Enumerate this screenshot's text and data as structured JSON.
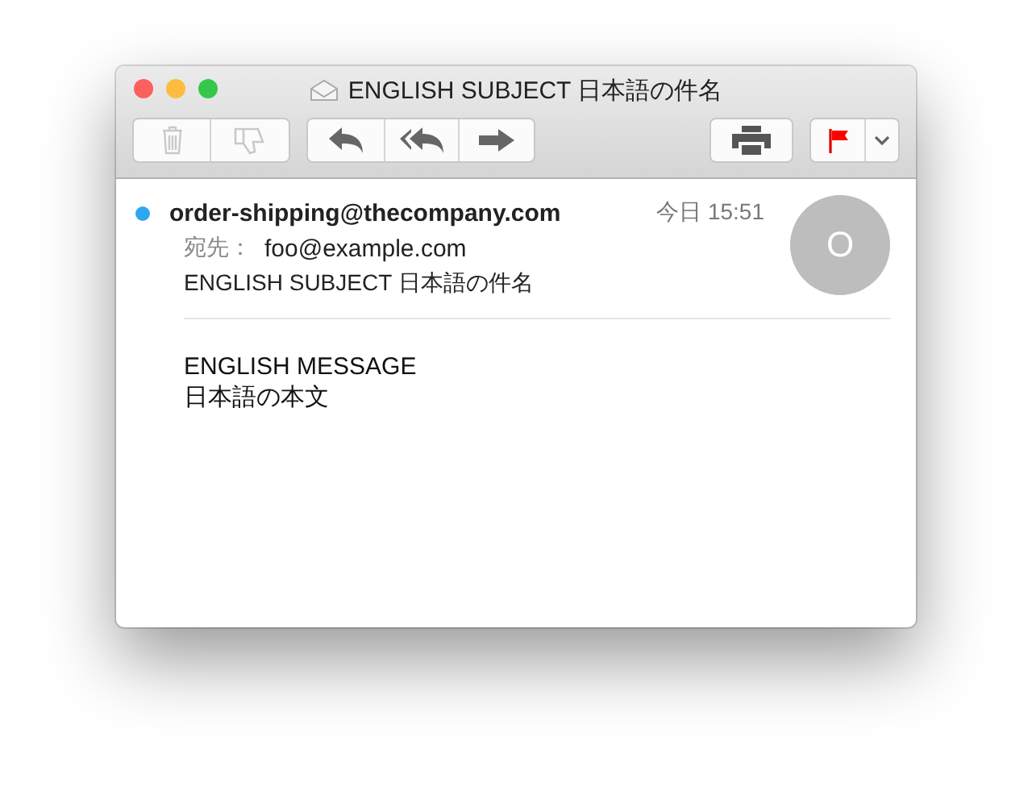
{
  "window": {
    "title": "ENGLISH SUBJECT 日本語の件名"
  },
  "toolbar": [
    {
      "group": [
        {
          "kind": "trash",
          "disabled": true
        },
        {
          "kind": "junk",
          "disabled": true
        }
      ]
    },
    {
      "group": [
        {
          "kind": "reply",
          "disabled": false
        },
        {
          "kind": "reply-all",
          "disabled": false
        },
        {
          "kind": "forward",
          "disabled": false
        }
      ]
    },
    {
      "group": [
        {
          "kind": "print",
          "disabled": false
        }
      ]
    },
    {
      "group": [
        {
          "kind": "flag",
          "disabled": false
        },
        {
          "kind": "caret",
          "disabled": false
        }
      ]
    }
  ],
  "message": {
    "unread": true,
    "sender": "order-shipping@thecompany.com",
    "time": "今日 15:51",
    "to_label": "宛先：",
    "to": "foo@example.com",
    "subject": "ENGLISH SUBJECT 日本語の件名",
    "avatar": "O",
    "body": [
      "ENGLISH MESSAGE",
      "日本語の本文"
    ]
  }
}
